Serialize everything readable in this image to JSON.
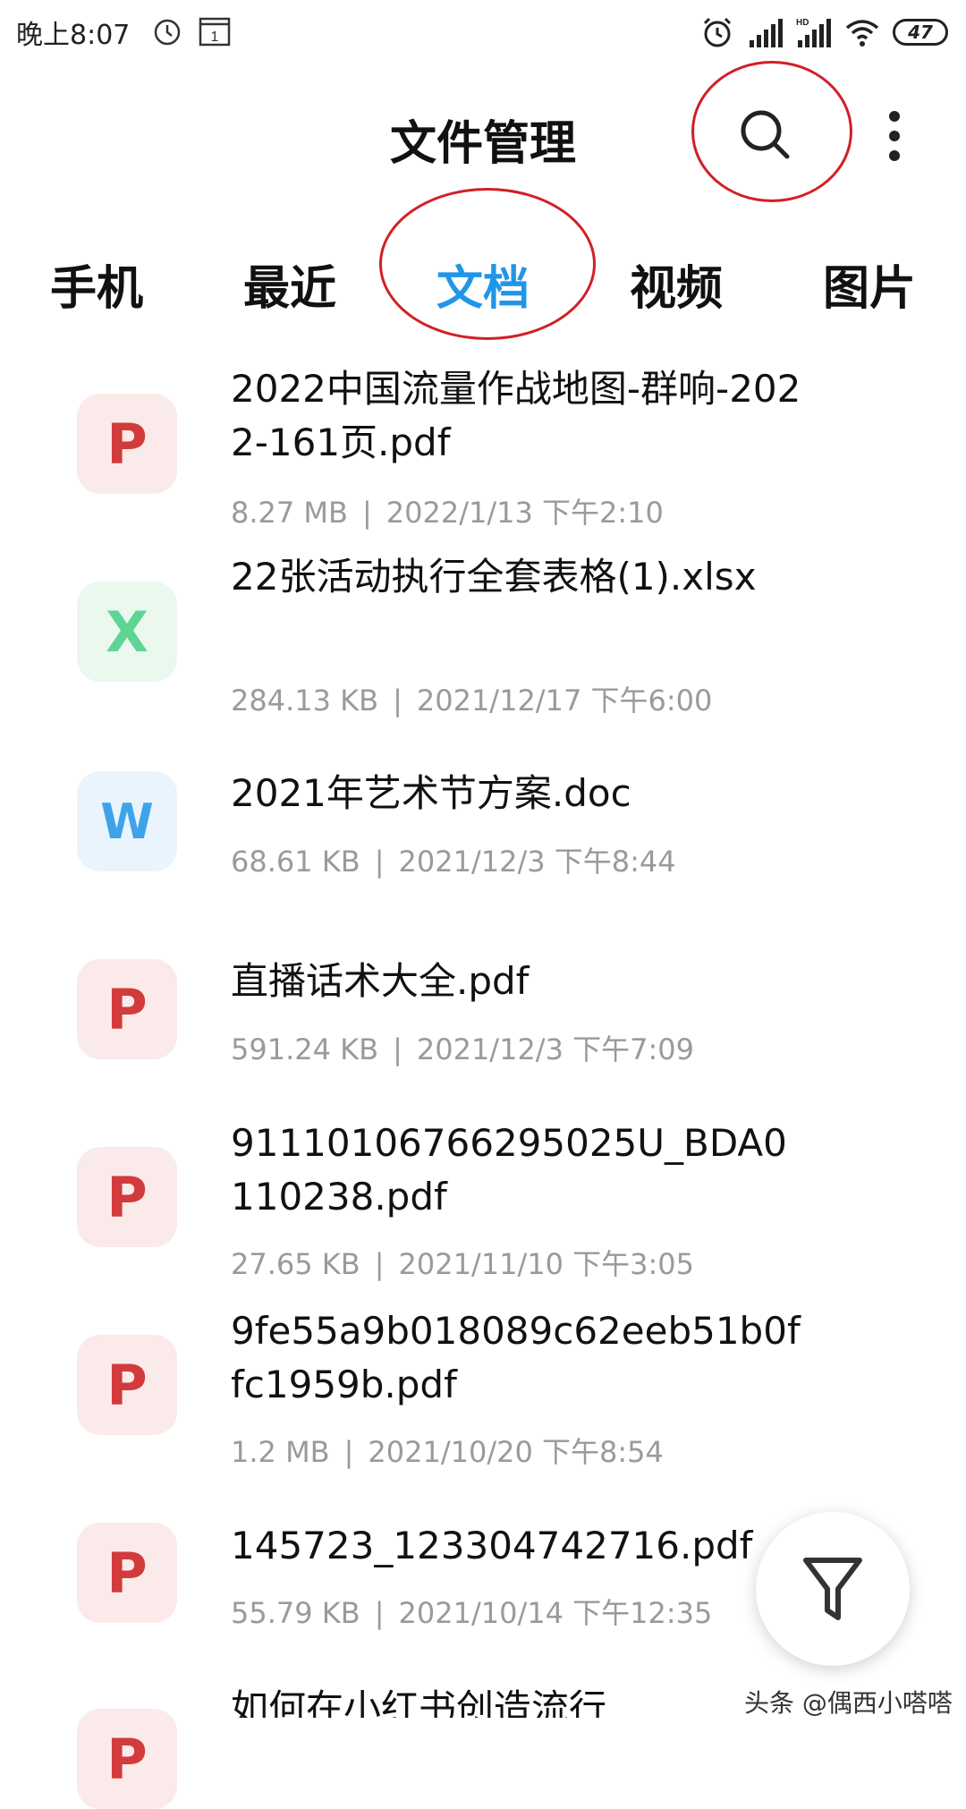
{
  "status_bar": {
    "time": "晚上8:07",
    "battery": "47",
    "icons": [
      "alarm-icon",
      "calendar-icon",
      "alarm-clock-icon",
      "signal-icon",
      "hd-signal-icon",
      "wifi-icon",
      "battery-icon"
    ]
  },
  "header": {
    "title": "文件管理",
    "search_icon": "search-icon",
    "more_icon": "more-vertical-icon"
  },
  "tabs": [
    {
      "label": "手机",
      "active": false
    },
    {
      "label": "最近",
      "active": false
    },
    {
      "label": "文档",
      "active": true
    },
    {
      "label": "视频",
      "active": false
    },
    {
      "label": "图片",
      "active": false
    }
  ],
  "files": [
    {
      "type_letter": "P",
      "kind": "pdf",
      "name": "2022中国流量作战地图-群响-2022-161页.pdf",
      "size": "8.27 MB",
      "date": "2022/1/13 下午2:10"
    },
    {
      "type_letter": "X",
      "kind": "xls",
      "name": "22张活动执行全套表格(1).xlsx",
      "size": "284.13 KB",
      "date": "2021/12/17 下午6:00"
    },
    {
      "type_letter": "W",
      "kind": "doc",
      "name": "2021年艺术节方案.doc",
      "size": "68.61 KB",
      "date": "2021/12/3 下午8:44"
    },
    {
      "type_letter": "P",
      "kind": "pdf",
      "name": "直播话术大全.pdf",
      "size": "591.24 KB",
      "date": "2021/12/3 下午7:09"
    },
    {
      "type_letter": "P",
      "kind": "pdf",
      "name": "91110106766295025U_BDA0110238.pdf",
      "size": "27.65 KB",
      "date": "2021/11/10 下午3:05"
    },
    {
      "type_letter": "P",
      "kind": "pdf",
      "name": "9fe55a9b018089c62eeb51b0ffc1959b.pdf",
      "size": "1.2 MB",
      "date": "2021/10/20 下午8:54"
    },
    {
      "type_letter": "P",
      "kind": "pdf",
      "name": "145723_123304742716.pdf",
      "size": "55.79 KB",
      "date": "2021/10/14 下午12:35"
    },
    {
      "type_letter": "P",
      "kind": "pdf",
      "name": "如何在小红书创造流行",
      "size": "",
      "date": ""
    }
  ],
  "meta_separator": "|",
  "fab": {
    "icon": "filter-icon"
  },
  "watermark": "头条 @偶西小嗒嗒",
  "colors": {
    "accent": "#2196e8",
    "annotation_red": "#d21f26",
    "pdf": "#d23b3b",
    "xls": "#5ed495",
    "doc": "#3fa3ea"
  }
}
